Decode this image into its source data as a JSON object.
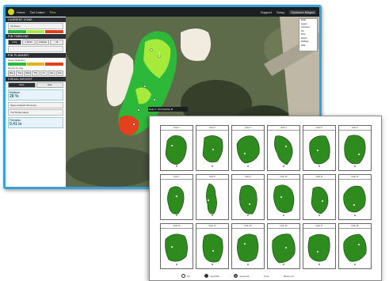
{
  "app": {
    "nav": [
      "Home",
      "Tall Cotton",
      "Pins"
    ],
    "nav_right": [
      "Support",
      "Setup",
      "Optimum Magno"
    ],
    "toolbox": [
      "Ruler",
      "Layers",
      "Contours",
      "Pin",
      "Print",
      "Export",
      "Settings",
      "Help"
    ],
    "sidebar": {
      "sections": {
        "current_zone": "CURRENT ZONE",
        "pin_timeline": "PIN TIMELINE",
        "pin_planner": "PIN PLANNER",
        "visual_insight": "VISUAL INSIGHT"
      },
      "zone_select": "All Zones",
      "timeline_tabs": [
        "1 Day",
        "1 Week",
        "2 Weeks",
        "All"
      ],
      "planner_rows": [
        "Green Selection",
        "Set pin by day"
      ],
      "planner_days": [
        "Mon",
        "Tue",
        "Wed",
        "Thu",
        "Fri",
        "Sat",
        "Sun"
      ],
      "insight_rows": [
        "Show",
        "Hide"
      ],
      "badges": [
        {
          "label": "Moisture",
          "value": "28 %"
        },
        {
          "label": "Firmness",
          "value": "0.41 in"
        }
      ],
      "footer_rows": [
        "Slope Analysis Summary",
        "Turf Performance"
      ]
    },
    "map": {
      "zone_colors": {
        "green": "#2db83a",
        "light": "#a6ea3c",
        "red": "#e3401e"
      },
      "tooltip": "Hole 3 · Pin Position B"
    }
  },
  "sheet": {
    "cells": [
      {
        "title": "Hole 1"
      },
      {
        "title": "Hole 2"
      },
      {
        "title": "Hole 3"
      },
      {
        "title": "Hole 4"
      },
      {
        "title": "Hole 5"
      },
      {
        "title": "Hole 6"
      },
      {
        "title": "Hole 7"
      },
      {
        "title": "Hole 8"
      },
      {
        "title": "Hole 9"
      },
      {
        "title": "Hole 10"
      },
      {
        "title": "Hole 11"
      },
      {
        "title": "Hole 12"
      },
      {
        "title": "Hole 13"
      },
      {
        "title": "Hole 14"
      },
      {
        "title": "Hole 15"
      },
      {
        "title": "Hole 16"
      },
      {
        "title": "Hole 17"
      },
      {
        "title": "Hole 18"
      }
    ],
    "legend": [
      "Pin",
      "Sprinkler",
      "Approach",
      "Front",
      "Back Left"
    ],
    "green_color": "#2e8c1f"
  }
}
